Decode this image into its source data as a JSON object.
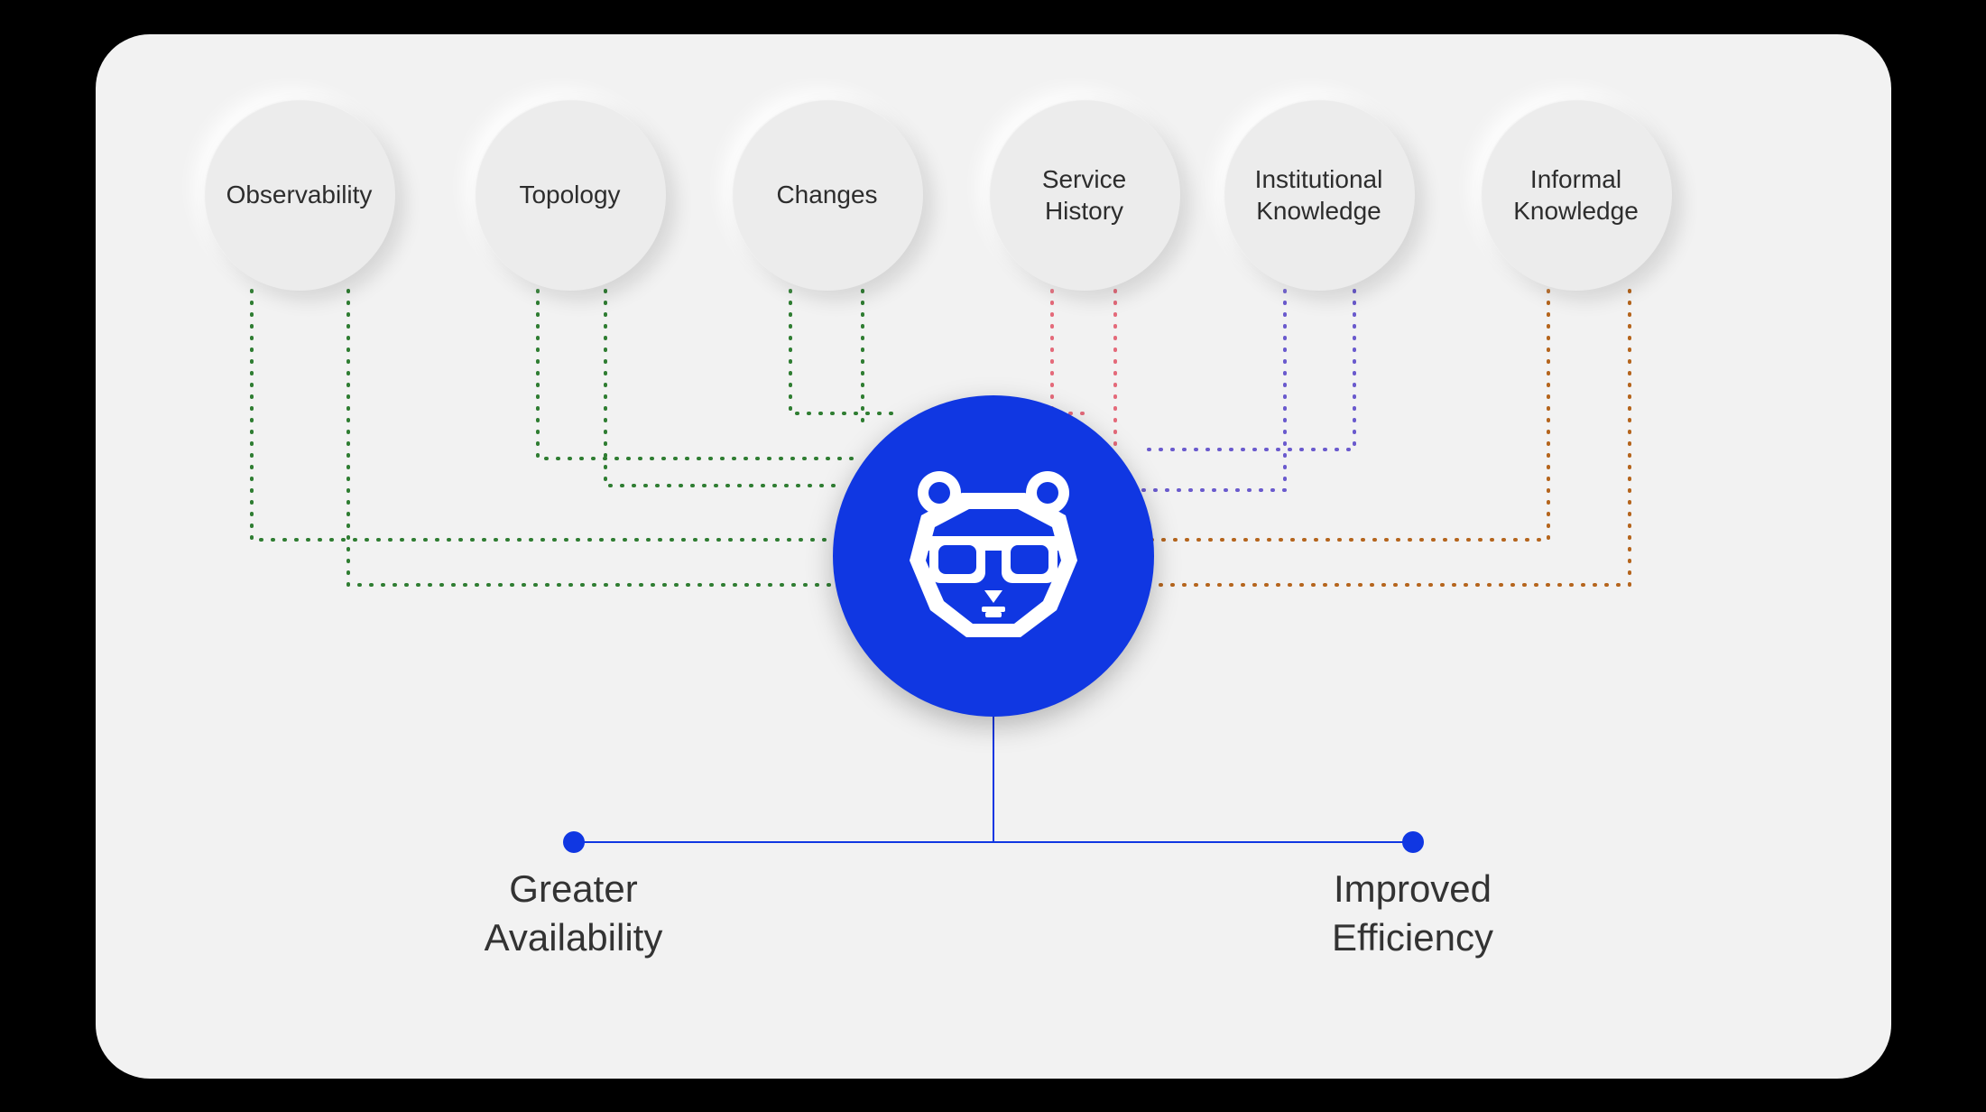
{
  "diagram": {
    "inputs": [
      {
        "label": "Observability"
      },
      {
        "label": "Topology"
      },
      {
        "label": "Changes"
      },
      {
        "label": "Service History"
      },
      {
        "label": "Institutional Knowledge"
      },
      {
        "label": "Informal Knowledge"
      }
    ],
    "central_icon": "bear-glasses-logo",
    "outputs": [
      {
        "label": "Greater Availability"
      },
      {
        "label": "Improved Efficiency"
      }
    ],
    "colors": {
      "accent": "#1037e2",
      "card_bg": "#f2f2f2",
      "node_bg": "#ececec",
      "connector_green": "#2f7d32",
      "connector_pink": "#e46a7a",
      "connector_purple": "#6a5acd",
      "connector_brown": "#b5651d"
    }
  }
}
